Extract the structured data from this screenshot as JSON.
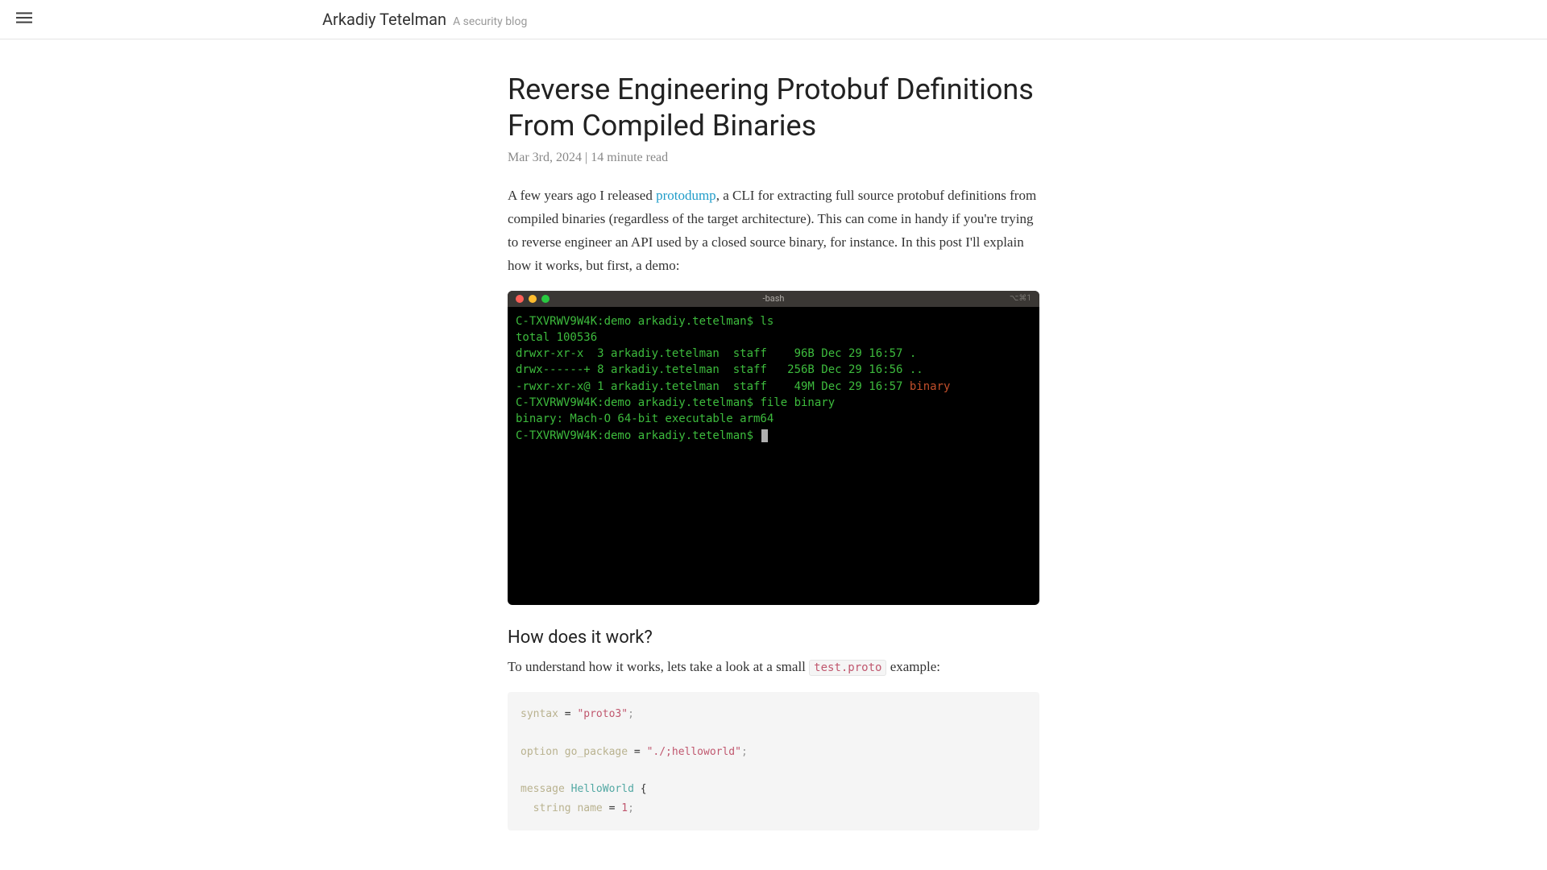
{
  "header": {
    "brand_name": "Arkadiy Tetelman",
    "brand_tagline": "A security blog"
  },
  "article": {
    "title": "Reverse Engineering Protobuf Definitions From Compiled Binaries",
    "meta": "Mar 3rd, 2024 | 14 minute read",
    "intro_pre": "A few years ago I released ",
    "intro_link": "protodump",
    "intro_post": ", a CLI for extracting full source protobuf definitions from compiled binaries (regardless of the target architecture). This can come in handy if you're trying to reverse engineer an API used by a closed source binary, for instance. In this post I'll explain how it works, but first, a demo:"
  },
  "terminal": {
    "title": "-bash",
    "right": "⌥⌘1",
    "lines": [
      {
        "prompt": "C-TXVRWV9W4K:demo arkadiy.tetelman$ ",
        "cmd": "ls"
      },
      {
        "out": "total 100536"
      },
      {
        "out": "drwxr-xr-x  3 arkadiy.tetelman  staff    96B Dec 29 16:57 ."
      },
      {
        "out": "drwx------+ 8 arkadiy.tetelman  staff   256B Dec 29 16:56 .."
      },
      {
        "out_pre": "-rwxr-xr-x@ 1 arkadiy.tetelman  staff    49M Dec 29 16:57 ",
        "out_red": "binary"
      },
      {
        "prompt": "C-TXVRWV9W4K:demo arkadiy.tetelman$ ",
        "cmd": "file binary"
      },
      {
        "out": "binary: Mach-O 64-bit executable arm64"
      },
      {
        "prompt": "C-TXVRWV9W4K:demo arkadiy.tetelman$ ",
        "cursor": true
      }
    ]
  },
  "section": {
    "title": "How does it work?",
    "p1_pre": "To understand how it works, lets take a look at a small ",
    "p1_code": "test.proto",
    "p1_post": " example:"
  },
  "proto": {
    "syntax_kw": "syntax",
    "eq": " = ",
    "syntax_val": "\"proto3\"",
    "semi": ";",
    "option_kw": "option",
    "option_name": "go_package",
    "option_val": "\"./;helloworld\"",
    "message_kw": "message",
    "message_name": "HelloWorld",
    "brace_open": " {",
    "field_type": "string",
    "field_name": "name",
    "field_num": "1"
  }
}
